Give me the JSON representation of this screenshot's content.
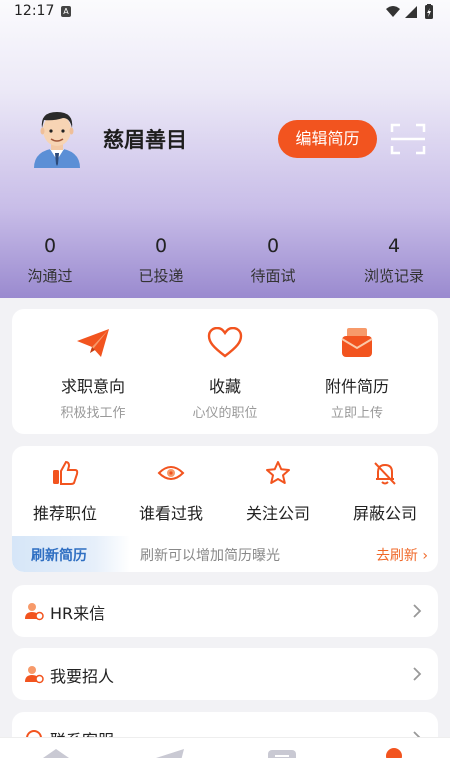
{
  "status": {
    "time": "12:17",
    "notif_letter": "A"
  },
  "profile": {
    "name": "慈眉善目",
    "edit_label": "编辑简历"
  },
  "stats": [
    {
      "value": "0",
      "label": "沟通过"
    },
    {
      "value": "0",
      "label": "已投递"
    },
    {
      "value": "0",
      "label": "待面试"
    },
    {
      "value": "4",
      "label": "浏览记录"
    }
  ],
  "quick_actions": [
    {
      "title": "求职意向",
      "subtitle": "积极找工作",
      "icon": "paper-plane-icon"
    },
    {
      "title": "收藏",
      "subtitle": "心仪的职位",
      "icon": "heart-icon"
    },
    {
      "title": "附件简历",
      "subtitle": "立即上传",
      "icon": "envelope-icon"
    }
  ],
  "secondary_actions": [
    {
      "title": "推荐职位",
      "icon": "thumbs-up-icon"
    },
    {
      "title": "谁看过我",
      "icon": "eye-icon"
    },
    {
      "title": "关注公司",
      "icon": "star-icon"
    },
    {
      "title": "屏蔽公司",
      "icon": "bell-off-icon"
    }
  ],
  "refresh": {
    "tag": "刷新简历",
    "text": "刷新可以增加简历曝光",
    "link": "去刷新 ›"
  },
  "menu": [
    {
      "label": "HR来信",
      "icon": "hr-letter-icon"
    },
    {
      "label": "我要招人",
      "icon": "recruit-icon"
    },
    {
      "label": "联系客服",
      "icon": "customer-service-icon"
    }
  ],
  "colors": {
    "accent": "#f2541f",
    "header_end": "#9a8acf",
    "link_blue": "#2f6fc2"
  }
}
